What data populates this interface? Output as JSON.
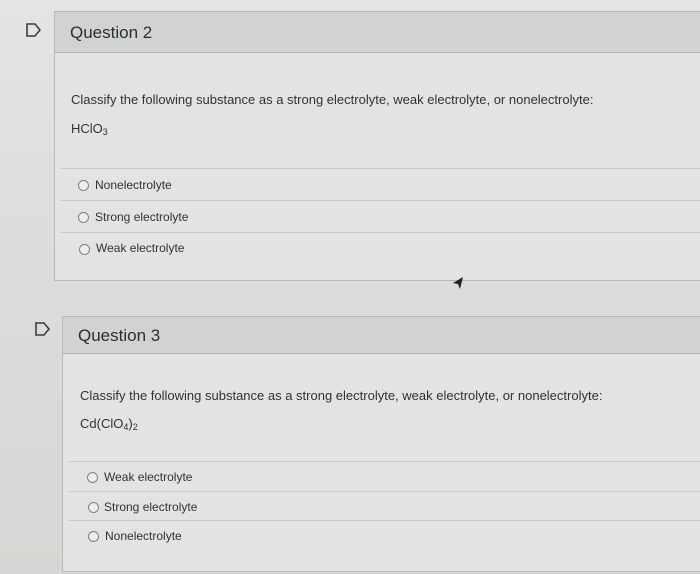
{
  "questions": [
    {
      "title": "Question 2",
      "prompt": "Classify the following substance as a strong electrolyte, weak electrolyte, or nonelectrolyte:",
      "formula": {
        "parts": [
          {
            "text": "HClO"
          },
          {
            "sub": "3"
          }
        ]
      },
      "options": [
        {
          "label": "Nonelectrolyte",
          "selected": false
        },
        {
          "label": "Strong electrolyte",
          "selected": false
        },
        {
          "label": "Weak electrolyte",
          "selected": false
        }
      ]
    },
    {
      "title": "Question 3",
      "prompt": "Classify the following substance as a strong electrolyte, weak electrolyte, or nonelectrolyte:",
      "formula": {
        "parts": [
          {
            "text": "Cd(ClO"
          },
          {
            "sub": "4"
          },
          {
            "text": ")"
          },
          {
            "sub": "2"
          }
        ]
      },
      "options": [
        {
          "label": "Weak electrolyte",
          "selected": false
        },
        {
          "label": "Strong electrolyte",
          "selected": false
        },
        {
          "label": "Nonelectrolyte",
          "selected": false
        }
      ]
    }
  ],
  "colors": {
    "flag_stroke": "#3a3d42",
    "card_bg": "#e3e4e2",
    "header_bg": "#d1d3d1"
  }
}
